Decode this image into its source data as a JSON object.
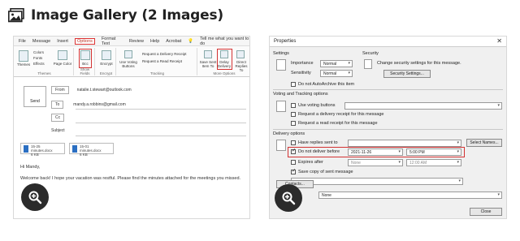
{
  "header": {
    "title": "Image Gallery (2 Images)"
  },
  "outlook": {
    "menu": [
      "File",
      "Message",
      "Insert",
      "Options",
      "Format Text",
      "Review",
      "Help",
      "Acrobat"
    ],
    "menu_active": "Options",
    "tell_me": "Tell me what you want to do",
    "ribbon": {
      "themes": "Themes",
      "colors": "Colors",
      "fonts": "Fonts",
      "effects": "Effects",
      "page_color": "Page Color",
      "bcc": "Bcc",
      "encrypt": "Encrypt",
      "use_voting": "Use Voting Buttons",
      "request_delivery": "Request a Delivery Receipt",
      "request_read": "Request a Read Receipt",
      "save_sent": "Save Sent Item To",
      "delay_delivery": "Delay Delivery",
      "direct_replies": "Direct Replies To",
      "groups": [
        "Themes",
        "Show Fields",
        "Encrypt",
        "Tracking",
        "More Options"
      ]
    },
    "from": "From",
    "from_email": "natalie.t.stewart@outlook.com",
    "to": "To",
    "to_email": "mandy.a.robbins@gmail.com",
    "cc": "Cc",
    "send": "Send",
    "subject": "Subject",
    "attachments": [
      {
        "name": "15-25 minutes.docx",
        "size": "6 KB"
      },
      {
        "name": "15-01 minutes.docx",
        "size": "6 KB"
      }
    ],
    "greeting": "Hi Mandy,",
    "body": "Welcome back! I hope your vacation was restful. Please find the minutes attached for the meetings you missed."
  },
  "dialog": {
    "title": "Properties",
    "close": "✕",
    "settings": "Settings",
    "security": "Security",
    "importance_label": "Importance",
    "importance_value": "Normal",
    "sensitivity_label": "Sensitivity",
    "sensitivity_value": "Normal",
    "security_text": "Change security settings for this message.",
    "security_button": "Security Settings...",
    "no_autoarchive": "Do not AutoArchive this item",
    "voting_section": "Voting and Tracking options",
    "use_voting": "Use voting buttons",
    "delivery_receipt": "Request a delivery receipt for this message",
    "read_receipt": "Request a read receipt for this message",
    "delivery_section": "Delivery options",
    "have_replies": "Have replies sent to",
    "select_names": "Select Names...",
    "do_not_deliver": "Do not deliver before",
    "deliver_date": "2021-11-26",
    "deliver_time": "5:00 PM",
    "expires": "Expires after",
    "expires_date": "None",
    "expires_time": "12:00 AM",
    "save_copy": "Save copy of sent message",
    "contacts": "Contacts...",
    "categories_value": "None",
    "close_button": "Close"
  },
  "colors": {
    "highlight": "#d33333"
  }
}
